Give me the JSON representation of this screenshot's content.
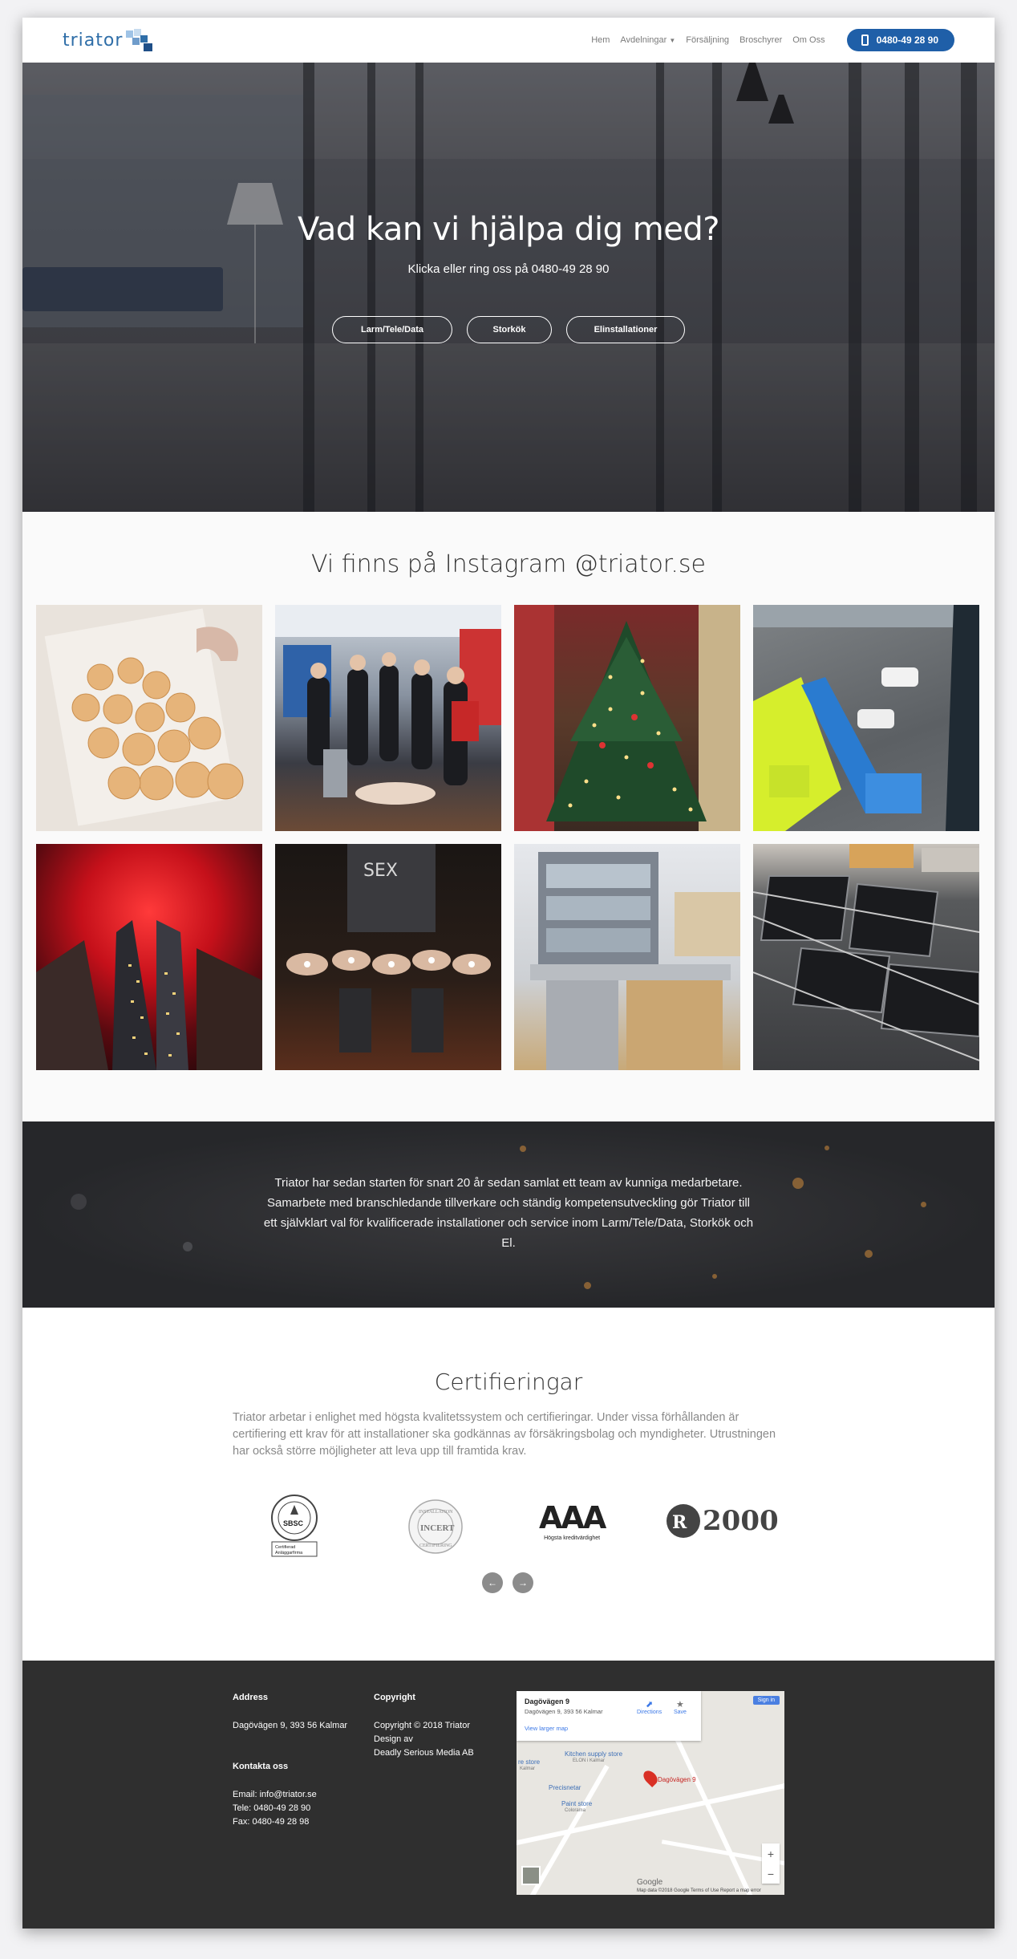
{
  "header": {
    "logo_text": "triator",
    "nav": [
      "Hem",
      "Avdelningar",
      "Försäljning",
      "Broschyrer",
      "Om Oss"
    ],
    "phone": "0480-49 28 90"
  },
  "hero": {
    "title": "Vad kan vi hjälpa dig med?",
    "subtitle": "Klicka eller ring oss på 0480-49 28 90",
    "buttons": [
      "Larm/Tele/Data",
      "Storkök",
      "Elinstallationer"
    ]
  },
  "instagram": {
    "title": "Vi finns på Instagram @triator.se",
    "tiles": [
      "semlor",
      "utbildning",
      "julgran",
      "skylift",
      "byggnad-roed",
      "haender",
      "storkok",
      "solpaneler"
    ]
  },
  "band": {
    "text": "Triator har sedan starten för snart 20 år sedan samlat ett team av kunniga medarbetare. Samarbete med branschledande tillverkare och ständig kompetensutveckling gör Triator till ett självklart val för kvalificerade installationer och service inom Larm/Tele/Data, Storkök och El."
  },
  "certifications": {
    "title": "Certifieringar",
    "text": "Triator arbetar i enlighet med högsta kvalitetssystem och certifieringar. Under vissa förhållanden är certifiering ett krav för att installationer ska godkännas av försäkringsbolag och myndigheter. Utrustningen har också större möjligheter att leva upp till framtida krav.",
    "logos": {
      "sbsc": "SBSC",
      "sbsc_sub1": "Certifierad",
      "sbsc_sub2": "Anläggarfirma",
      "incert": "INCERT",
      "incert_top": "INSTALLATION",
      "incert_bottom": "CERTIFIERING",
      "aaa": "AAA",
      "aaa_sub": "Högsta kreditvärdighet",
      "fr2000": "2000"
    }
  },
  "footer": {
    "address_head": "Address",
    "address": "Dagövägen 9, 393 56 Kalmar",
    "contact_head": "Kontakta oss",
    "email": "Email: info@triator.se",
    "tele": "Tele: 0480-49 28 90",
    "fax": "Fax: 0480-49 28 98",
    "copyright_head": "Copyright",
    "copyright_line1": "Copyright © 2018 Triator",
    "copyright_line2": "Design av",
    "copyright_line3": "Deadly Serious Media AB"
  },
  "map": {
    "place": "Dagövägen 9",
    "address": "Dagövägen 9, 393 56 Kalmar",
    "larger": "View larger map",
    "directions": "Directions",
    "save": "Save",
    "signin": "Sign in",
    "pin_label": "Dagövägen 9",
    "poi1": "Kitchen supply store",
    "poi1_sub": "ELON i Kalmar",
    "poi2": "Paint store",
    "poi2_sub": "Colorama",
    "poi3": "Precisnetar",
    "poi4": "re store",
    "poi4_sub": "Kalmar",
    "brand": "Google",
    "attribution": "Map data ©2018 Google   Terms of Use   Report a map error"
  },
  "colors": {
    "accent": "#1f5fa8",
    "footer": "#2f2f2f",
    "band": "#2a2a2d"
  }
}
